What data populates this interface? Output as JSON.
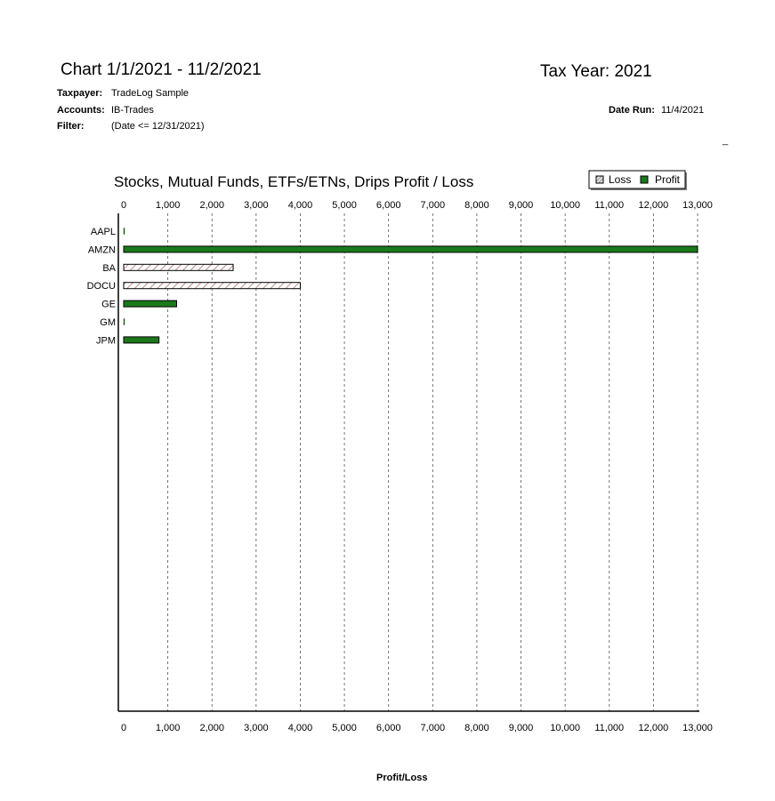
{
  "header": {
    "chart_title": "Chart  1/1/2021 - 11/2/2021",
    "tax_year_label": "Tax Year:  2021",
    "taxpayer_label": "Taxpayer:",
    "taxpayer_value": "TradeLog Sample",
    "accounts_label": "Accounts:",
    "accounts_value": "IB-Trades",
    "filter_label": "Filter:",
    "filter_value": "(Date <= 12/31/2021)",
    "date_run_label": "Date Run:",
    "date_run_value": "11/4/2021",
    "stray_mark": "_"
  },
  "colors": {
    "profit": "#1a7a1a",
    "loss_hatch": "#b07070",
    "grid": "#555555"
  },
  "chart_data": {
    "type": "bar",
    "orientation": "horizontal",
    "title": "Stocks, Mutual Funds, ETFs/ETNs, Drips Profit / Loss",
    "xlabel": "Profit/Loss",
    "ylabel": "",
    "categories": [
      "AAPL",
      "AMZN",
      "BA",
      "DOCU",
      "GE",
      "GM",
      "JPM"
    ],
    "series": [
      {
        "name": "Loss",
        "values": [
          0,
          0,
          2480,
          4000,
          0,
          0,
          0
        ]
      },
      {
        "name": "Profit",
        "values": [
          10,
          13000,
          0,
          0,
          1200,
          10,
          800
        ]
      }
    ],
    "xlim": [
      0,
      13000
    ],
    "xticks": [
      0,
      1000,
      2000,
      3000,
      4000,
      5000,
      6000,
      7000,
      8000,
      9000,
      10000,
      11000,
      12000,
      13000
    ],
    "xtick_labels": [
      "0",
      "1,000",
      "2,000",
      "3,000",
      "4,000",
      "5,000",
      "6,000",
      "7,000",
      "8,000",
      "9,000",
      "10,000",
      "11,000",
      "12,000",
      "13,000"
    ],
    "grid": true,
    "legend_position": "top-right"
  }
}
